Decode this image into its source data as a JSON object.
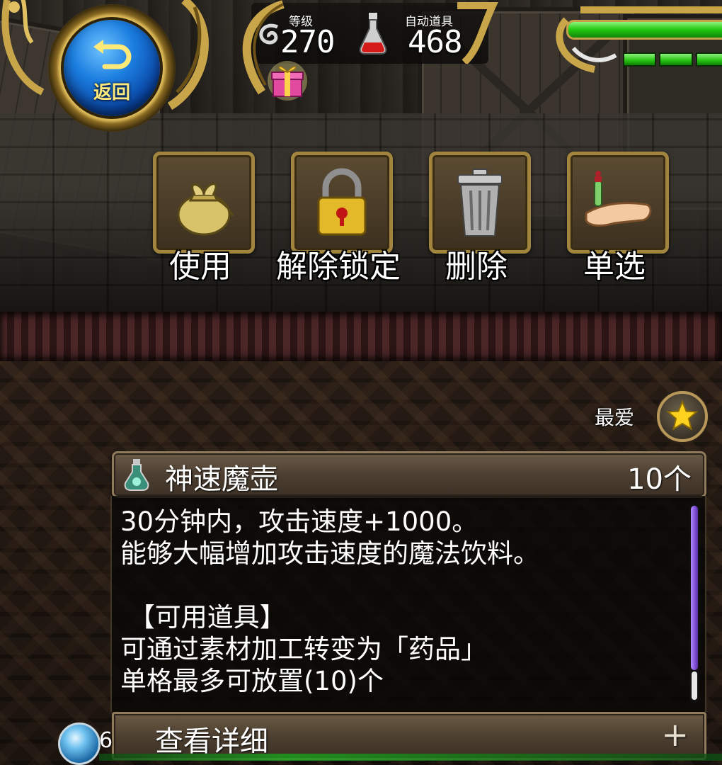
{
  "back_button": {
    "label": "返回"
  },
  "status": {
    "level_label": "等级",
    "level_value": "270",
    "auto_item_label": "自动道具",
    "auto_item_value": "468"
  },
  "hp": {
    "fill_percent": 100
  },
  "actions": [
    {
      "label": "使用",
      "icon": "bag-icon"
    },
    {
      "label": "解除锁定",
      "icon": "lock-icon"
    },
    {
      "label": "删除",
      "icon": "trash-icon"
    },
    {
      "label": "单选",
      "icon": "hand-select-icon"
    }
  ],
  "favorite": {
    "label": "最爱",
    "icon": "star-icon"
  },
  "item": {
    "name": "神速魔壶",
    "count": "10个",
    "icon": "potion-flask-icon",
    "description": "30分钟内，攻击速度+1000。\n能够大幅增加攻击速度的魔法饮料。\n\n 【可用道具】\n可通过素材加工转变为「药品」\n单格最多可放置(10)个"
  },
  "detail_button": {
    "label": "查看详细",
    "icon": "plus-icon",
    "icon_text": "+"
  },
  "bottom": {
    "orb_value": "6"
  },
  "colors": {
    "gold": "#c8a24a",
    "hp_green": "#21c70f",
    "scroll_purple": "#7f4ed6",
    "panel_brown": "#4d3f31"
  }
}
